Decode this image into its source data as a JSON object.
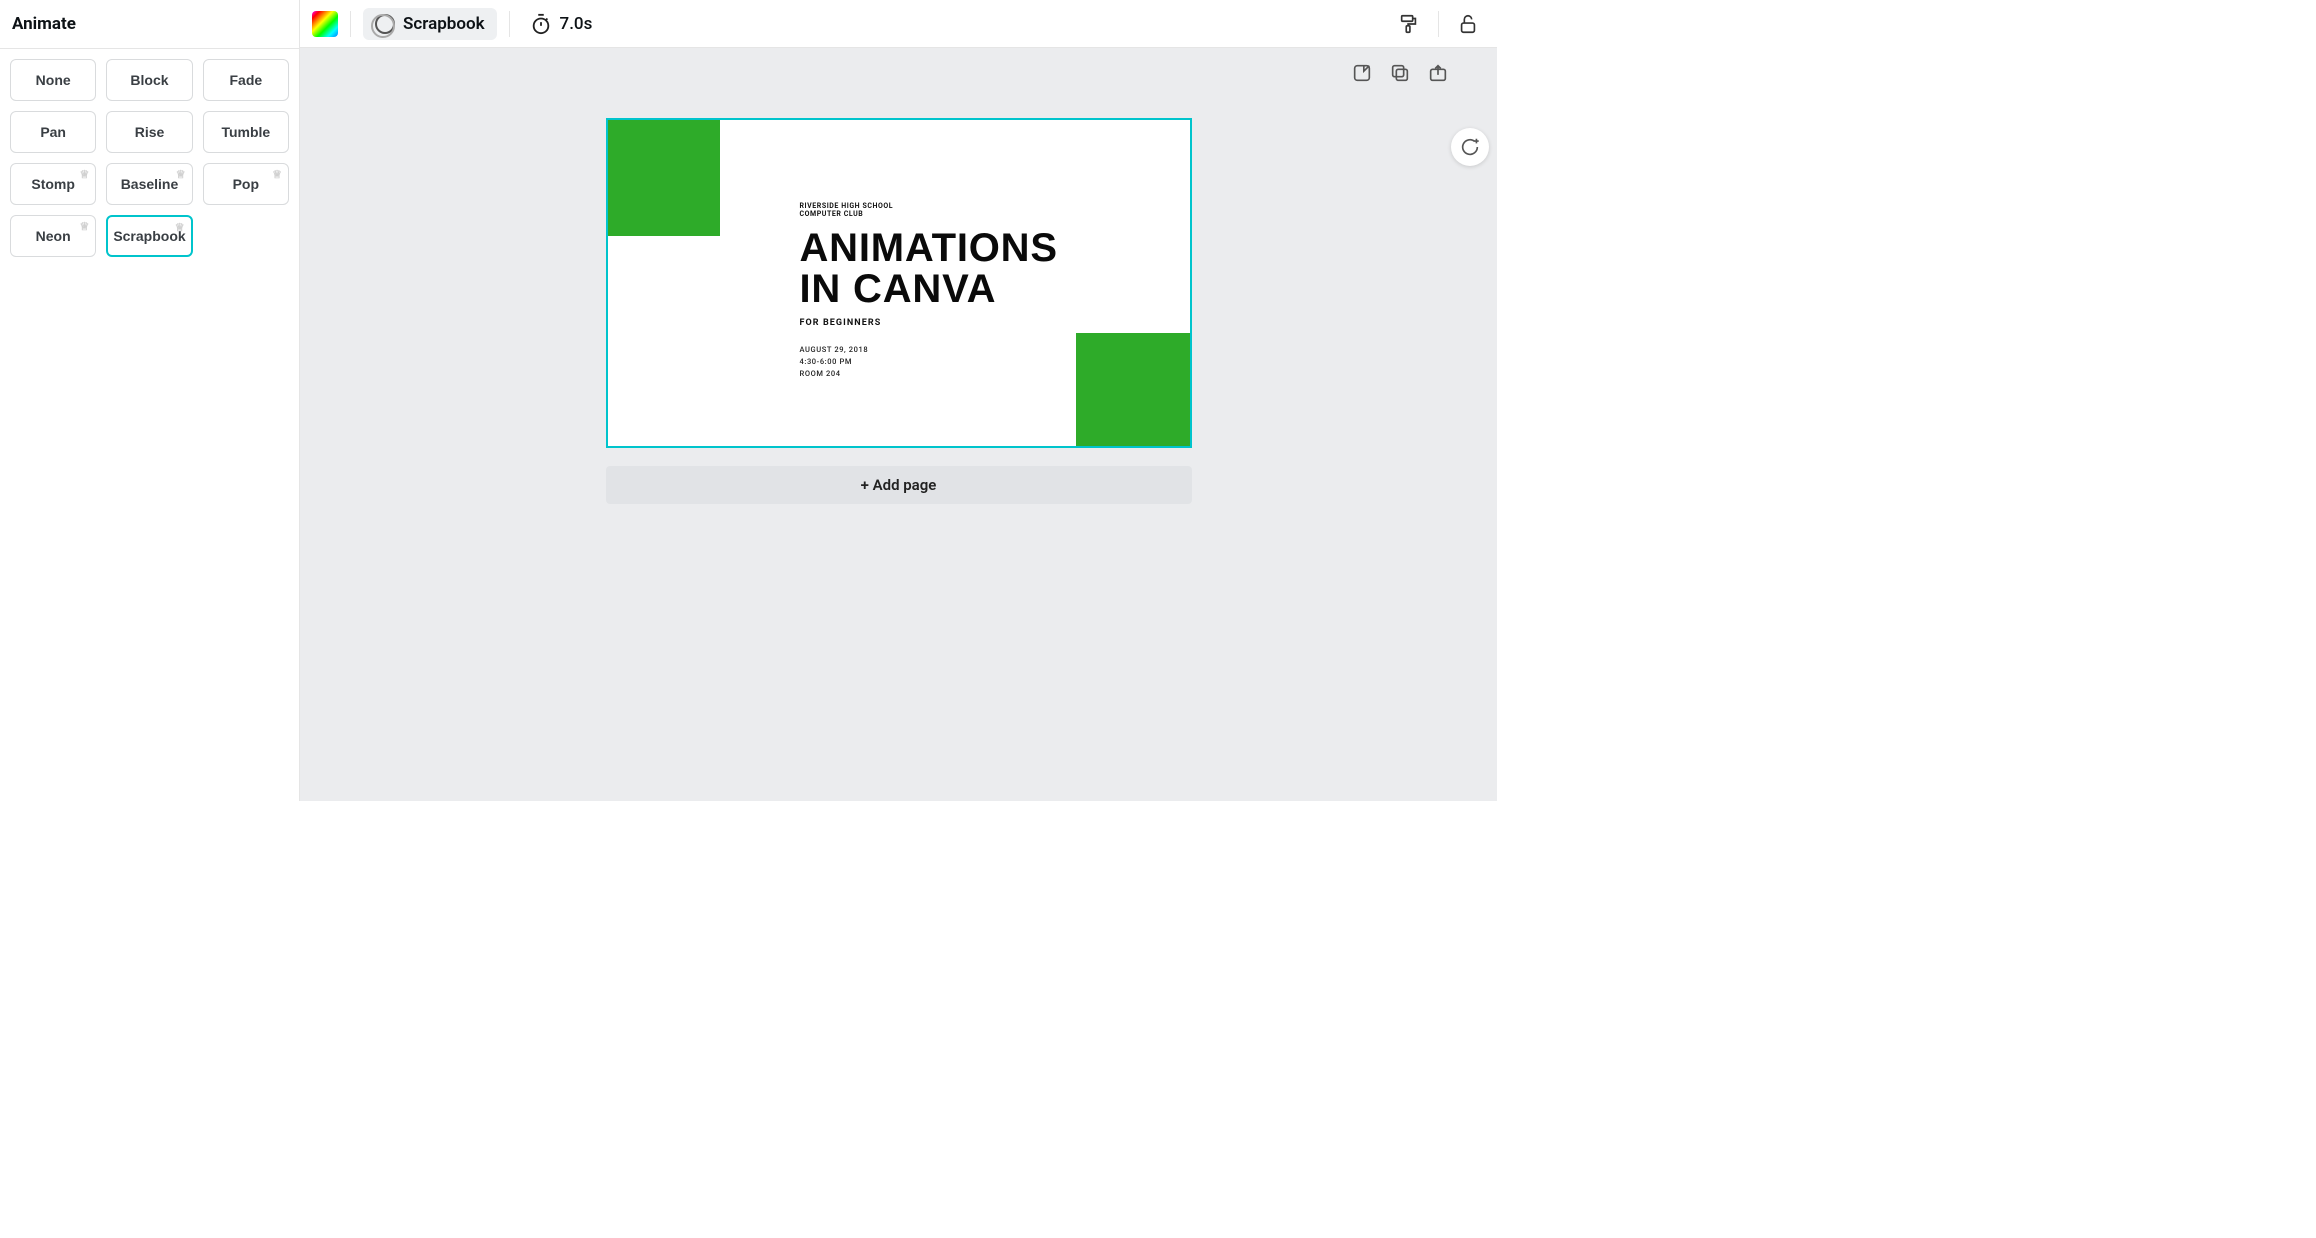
{
  "sidebar": {
    "title": "Animate",
    "options": [
      {
        "label": "None",
        "premium": false,
        "selected": false
      },
      {
        "label": "Block",
        "premium": false,
        "selected": false
      },
      {
        "label": "Fade",
        "premium": false,
        "selected": false
      },
      {
        "label": "Pan",
        "premium": false,
        "selected": false
      },
      {
        "label": "Rise",
        "premium": false,
        "selected": false
      },
      {
        "label": "Tumble",
        "premium": false,
        "selected": false
      },
      {
        "label": "Stomp",
        "premium": true,
        "selected": false
      },
      {
        "label": "Baseline",
        "premium": true,
        "selected": false
      },
      {
        "label": "Pop",
        "premium": true,
        "selected": false
      },
      {
        "label": "Neon",
        "premium": true,
        "selected": false
      },
      {
        "label": "Scrapbook",
        "premium": true,
        "selected": true
      }
    ]
  },
  "toolbar": {
    "animation_label": "Scrapbook",
    "duration": "7.0s"
  },
  "canvas": {
    "slide": {
      "org_line1": "RIVERSIDE HIGH SCHOOL",
      "org_line2": "COMPUTER CLUB",
      "title_line1": "ANIMATIONS",
      "title_line2": "IN CANVA",
      "subtitle": "FOR BEGINNERS",
      "date": "AUGUST 29, 2018",
      "time": "4:30-6:00 PM",
      "room": "ROOM 204",
      "accent_color": "#2eab29",
      "selection_color": "#00c4cc"
    },
    "add_page_label": "+ Add page"
  }
}
